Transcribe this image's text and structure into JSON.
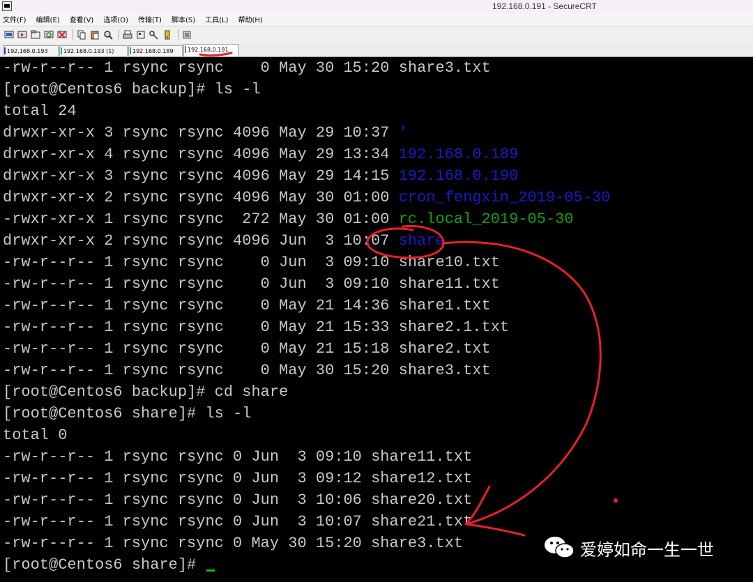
{
  "window": {
    "title": "192.168.0.191 - SecureCRT"
  },
  "menu": [
    "文件(F)",
    "编辑(E)",
    "查看(V)",
    "选项(O)",
    "传输(T)",
    "脚本(S)",
    "工具(L)",
    "帮助(H)"
  ],
  "toolbar_icons": [
    "connect-icon",
    "quick-connect-icon",
    "connect-tab-icon",
    "reconnect-icon",
    "disconnect-icon",
    "copy-icon",
    "paste-icon",
    "find-icon",
    "print-icon",
    "settings-icon",
    "key-icon",
    "help-icon",
    "map-icon"
  ],
  "tabs": [
    {
      "label": "192.168.0.193",
      "color": "#3030c0"
    },
    {
      "label": "192.168.0.193 (1)",
      "color": "#30b030"
    },
    {
      "label": "192.168.0.189",
      "color": "#30b030"
    },
    {
      "label": "192.168.0.191",
      "color": "#30b030",
      "active": true
    }
  ],
  "terminal": {
    "lines": [
      {
        "text": "-rw-r--r-- 1 rsync rsync    0 May 30 15:20 share3.txt"
      },
      {
        "text": "[root@Centos6 backup]# ls -l"
      },
      {
        "text": "total 24"
      },
      {
        "prefix": "drwxr-xr-x 3 rsync rsync 4096 May 29 10:37 ",
        "name": "'",
        "cls": "c-blue"
      },
      {
        "prefix": "drwxr-xr-x 4 rsync rsync 4096 May 29 13:34 ",
        "name": "192.168.0.189",
        "cls": "c-blue"
      },
      {
        "prefix": "drwxr-xr-x 3 rsync rsync 4096 May 29 14:15 ",
        "name": "192.168.0.190",
        "cls": "c-blue"
      },
      {
        "prefix": "drwxr-xr-x 2 rsync rsync 4096 May 30 01:00 ",
        "name": "cron_fengxin_2019-05-30",
        "cls": "c-blue"
      },
      {
        "prefix": "-rwxr-xr-x 1 rsync rsync  272 May 30 01:00 ",
        "name": "rc.local_2019-05-30",
        "cls": "c-green"
      },
      {
        "prefix": "drwxr-xr-x 2 rsync rsync 4096 Jun  3 10:07 ",
        "name": "share",
        "cls": "c-blue"
      },
      {
        "text": "-rw-r--r-- 1 rsync rsync    0 Jun  3 09:10 share10.txt"
      },
      {
        "text": "-rw-r--r-- 1 rsync rsync    0 Jun  3 09:10 share11.txt"
      },
      {
        "text": "-rw-r--r-- 1 rsync rsync    0 May 21 14:36 share1.txt"
      },
      {
        "text": "-rw-r--r-- 1 rsync rsync    0 May 21 15:33 share2.1.txt"
      },
      {
        "text": "-rw-r--r-- 1 rsync rsync    0 May 21 15:18 share2.txt"
      },
      {
        "text": "-rw-r--r-- 1 rsync rsync    0 May 30 15:20 share3.txt"
      },
      {
        "text": "[root@Centos6 backup]# cd share"
      },
      {
        "text": "[root@Centos6 share]# ls -l"
      },
      {
        "text": "total 0"
      },
      {
        "text": "-rw-r--r-- 1 rsync rsync 0 Jun  3 09:10 share11.txt"
      },
      {
        "text": "-rw-r--r-- 1 rsync rsync 0 Jun  3 09:12 share12.txt"
      },
      {
        "text": "-rw-r--r-- 1 rsync rsync 0 Jun  3 10:06 share20.txt"
      },
      {
        "text": "-rw-r--r-- 1 rsync rsync 0 Jun  3 10:07 share21.txt"
      },
      {
        "text": "-rw-r--r-- 1 rsync rsync 0 May 30 15:20 share3.txt"
      },
      {
        "text": "[root@Centos6 share]# ",
        "cursor": true
      }
    ]
  },
  "colors": {
    "annotation": "#e8202a",
    "dir": "#1c18c6",
    "exec": "#10a010",
    "text": "#c8c8c8"
  },
  "watermark": {
    "text": "爱婷如命一生一世",
    "icon": "wechat-icon"
  }
}
